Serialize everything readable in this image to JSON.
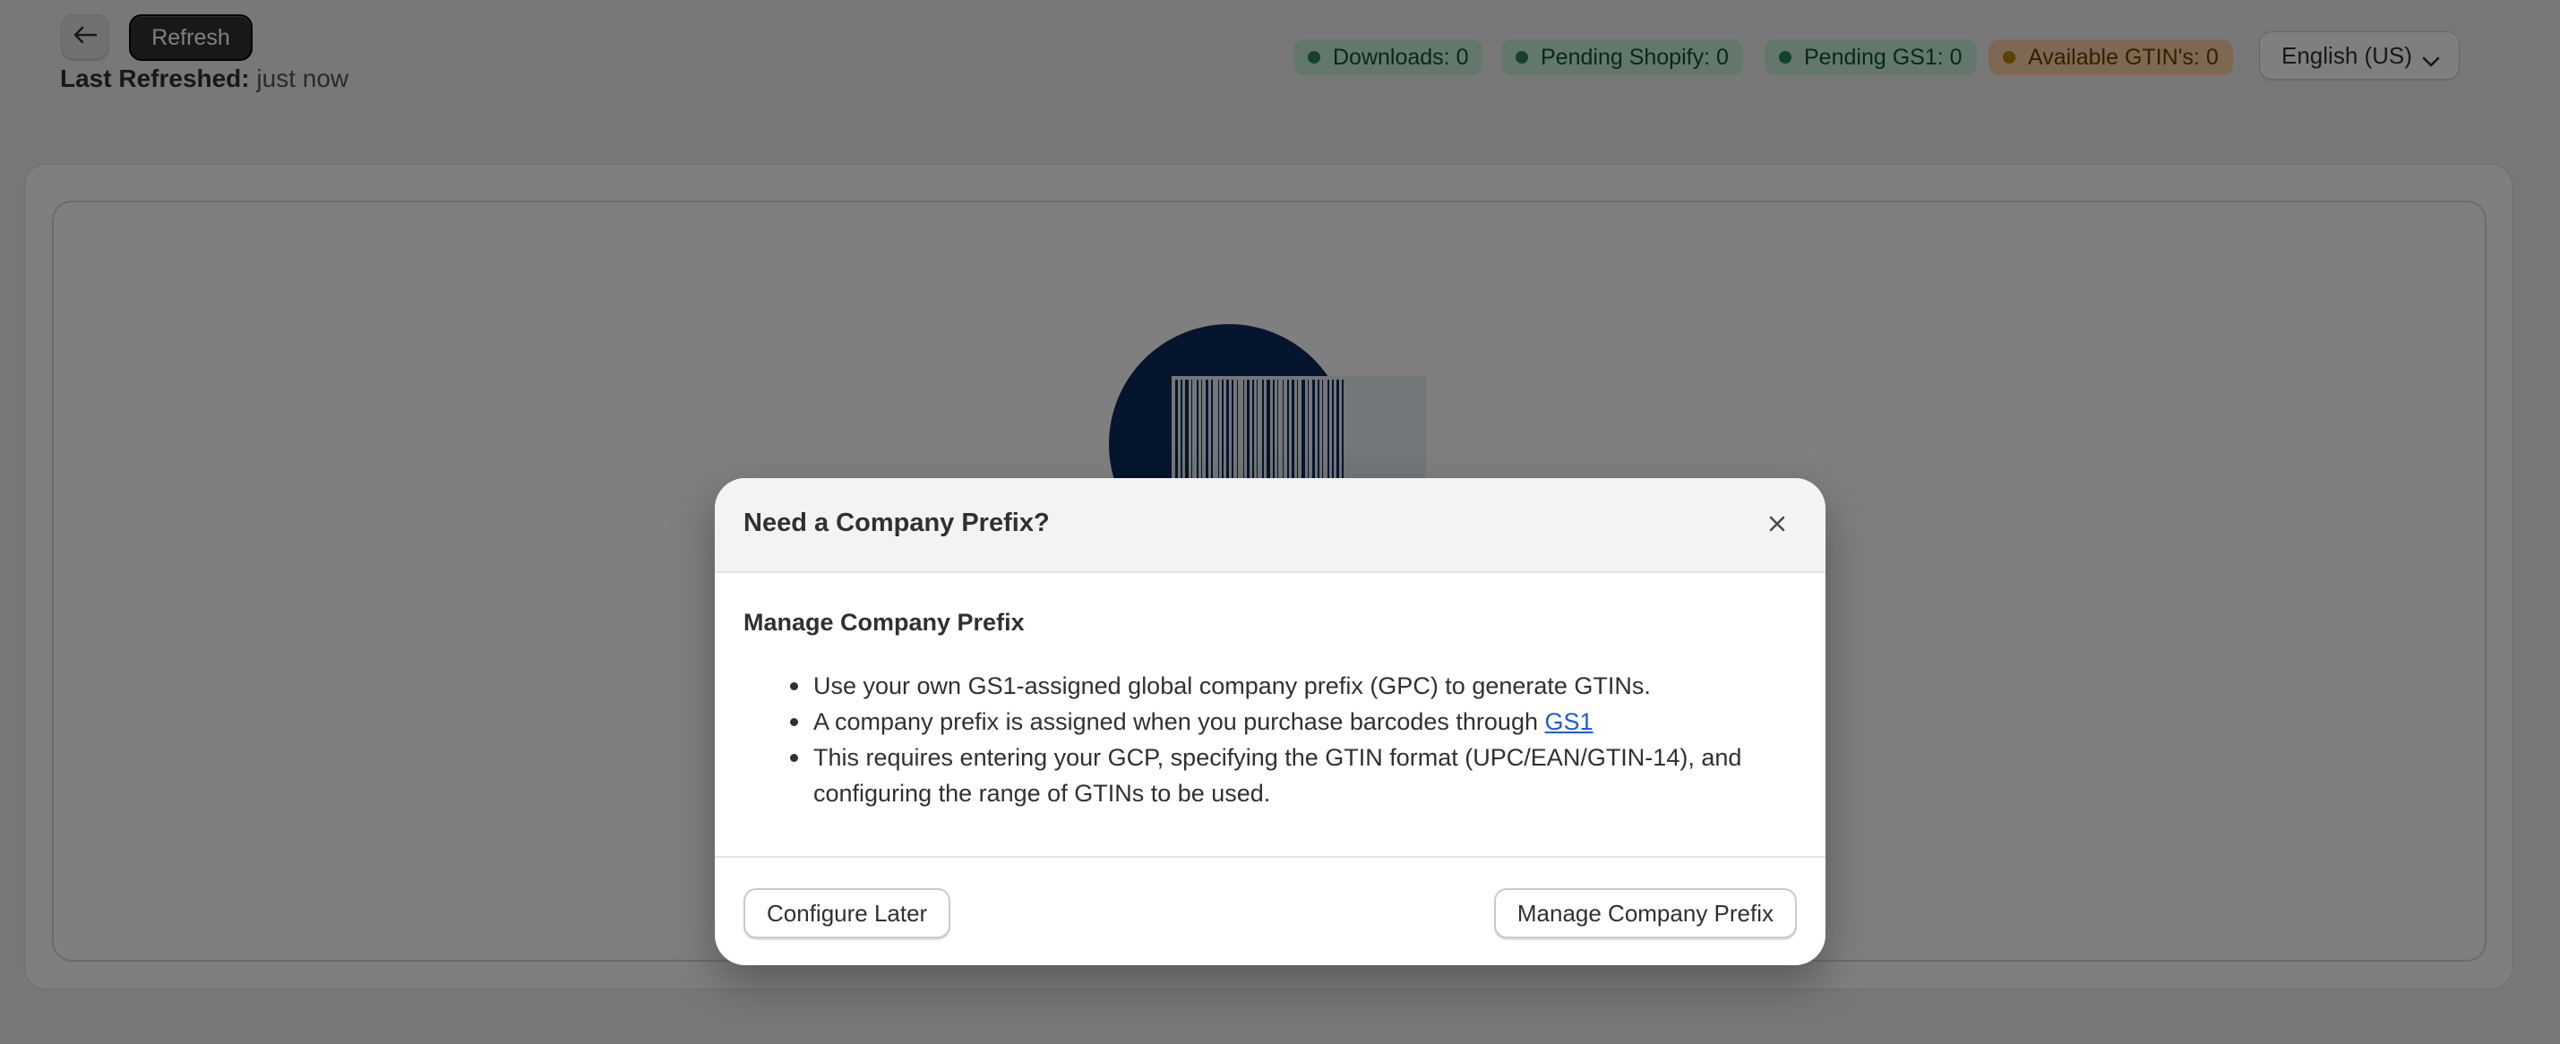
{
  "toolbar": {
    "refresh_label": "Refresh",
    "last_refreshed_label": "Last Refreshed:",
    "last_refreshed_value": "just now"
  },
  "badges": [
    {
      "label": "Downloads: 0",
      "status": "success",
      "color": "#29845a"
    },
    {
      "label": "Pending Shopify: 0",
      "status": "success",
      "color": "#29845a"
    },
    {
      "label": "Pending GS1: 0",
      "status": "success",
      "color": "#29845a"
    },
    {
      "label": "Available GTIN's: 0",
      "status": "warning",
      "color": "#b28400"
    }
  ],
  "language": {
    "selected": "English (US)"
  },
  "modal": {
    "title": "Need a Company Prefix?",
    "subtitle": "Manage Company Prefix",
    "bullet1": "Use your own GS1-assigned global company prefix (GPC) to generate GTINs.",
    "bullet2_text": "A company prefix is assigned when you purchase barcodes through",
    "bullet2_link": "GS1",
    "bullet3": "This requires entering your GCP, specifying the GTIN format (UPC/EAN/GTIN-14), and configuring the range of GTINs to be used.",
    "secondary_button": "Configure Later",
    "primary_button": "Manage Company Prefix"
  },
  "icons": {
    "back": "arrow-left-icon",
    "chevron": "chevron-down-icon",
    "close": "close-icon",
    "illustration": "barcode-illustration"
  },
  "colors": {
    "illustration_primary": "#0b2a5b",
    "overlay": "rgba(0,0,0,0.5)",
    "link": "#1f5bd8"
  }
}
